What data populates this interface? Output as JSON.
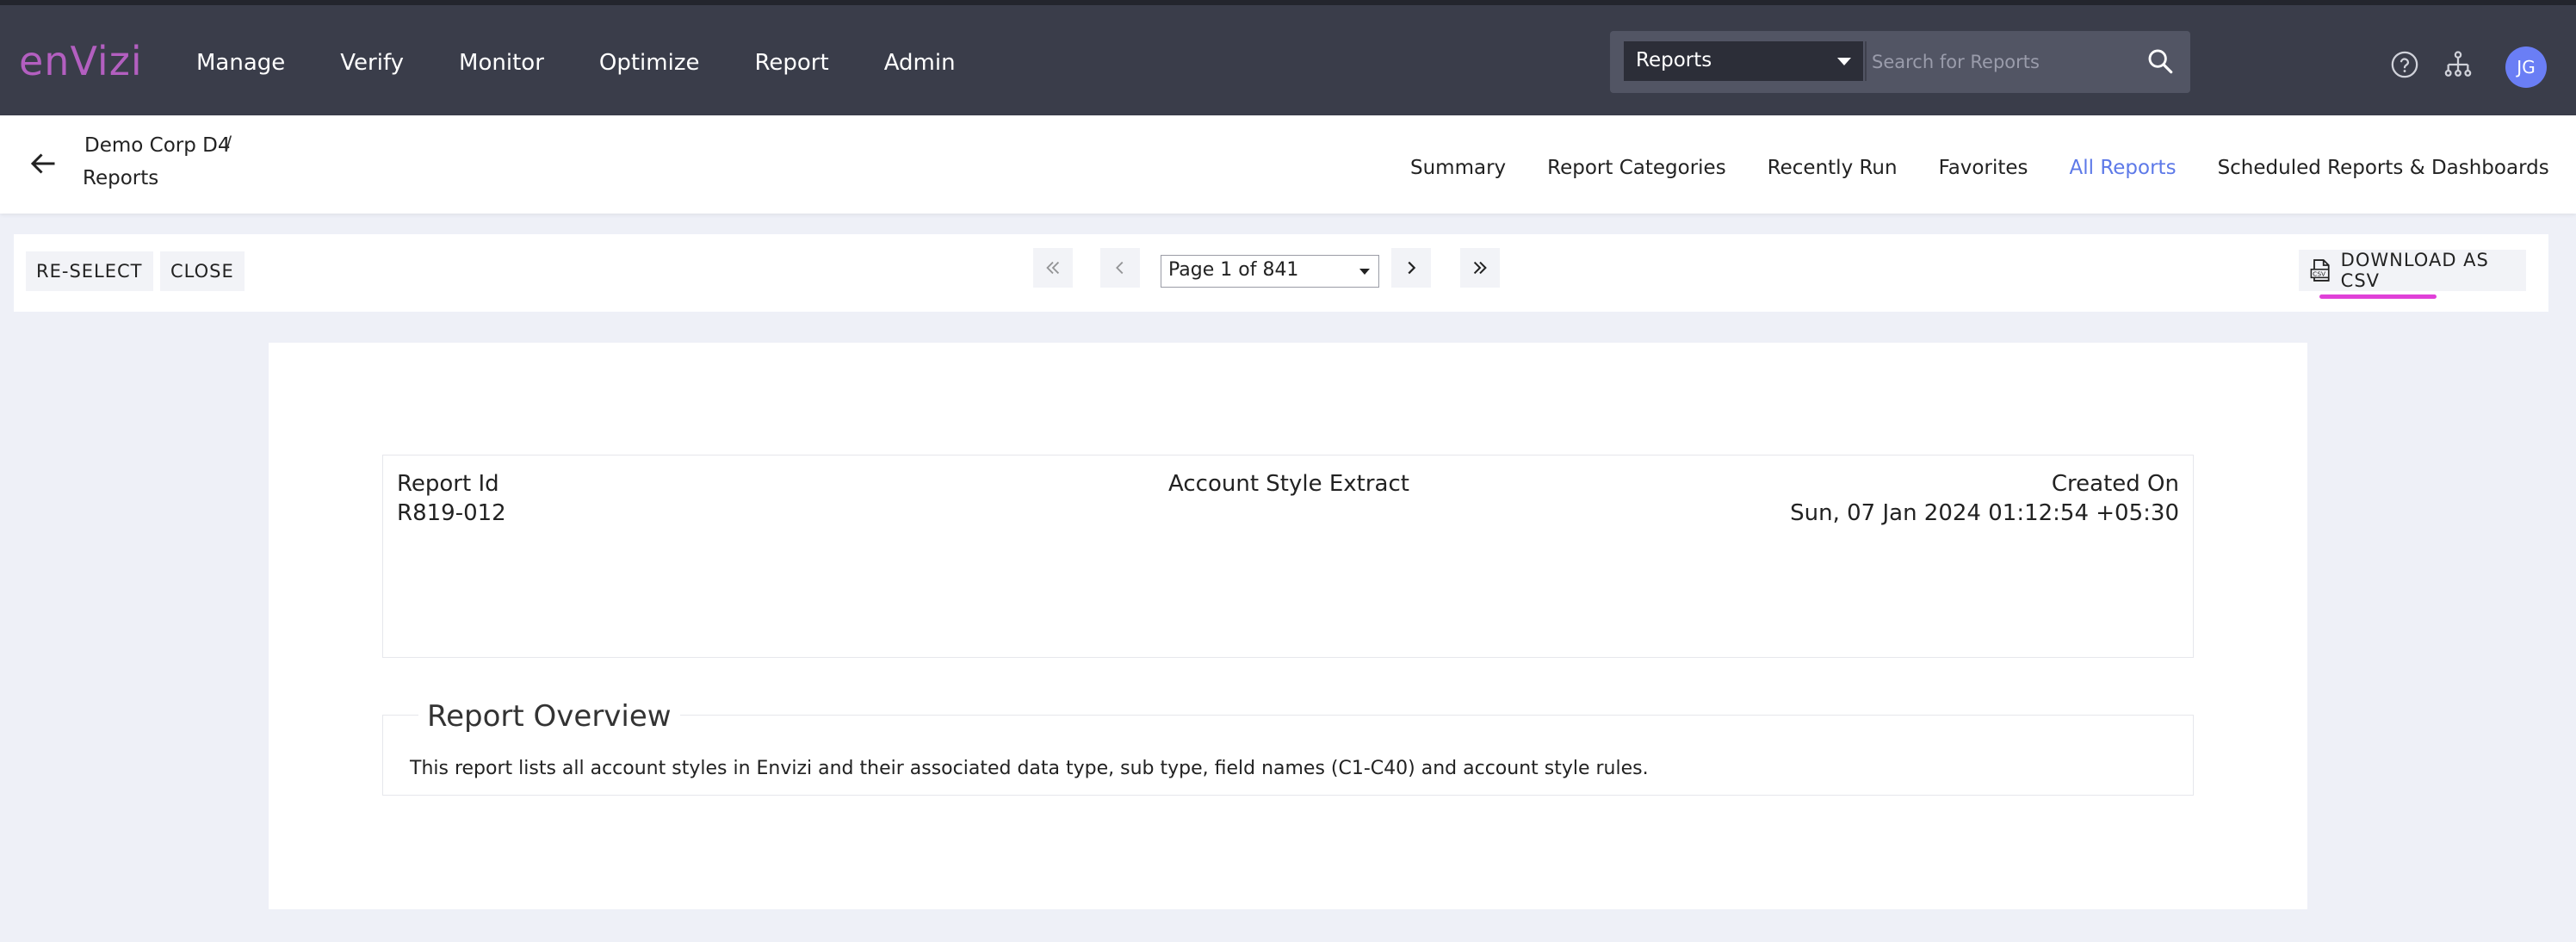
{
  "app": {
    "logo": "enVizi",
    "nav": [
      "Manage",
      "Verify",
      "Monitor",
      "Optimize",
      "Report",
      "Admin"
    ],
    "search": {
      "scope": "Reports",
      "placeholder": "Search for Reports"
    },
    "avatar_initials": "JG",
    "icons": [
      "help-icon",
      "hierarchy-icon",
      "search-icon"
    ]
  },
  "breadcrumb": {
    "parent": "Demo Corp D4",
    "separator": "/",
    "current": "Reports"
  },
  "tabs": [
    {
      "label": "Summary",
      "active": false
    },
    {
      "label": "Report Categories",
      "active": false
    },
    {
      "label": "Recently Run",
      "active": false
    },
    {
      "label": "Favorites",
      "active": false
    },
    {
      "label": "All Reports",
      "active": true
    },
    {
      "label": "Scheduled Reports & Dashboards",
      "active": false
    }
  ],
  "toolbar": {
    "reselect_label": "RE-SELECT",
    "close_label": "CLOSE",
    "page_label": "Page 1 of 841",
    "download_label": "DOWNLOAD AS CSV"
  },
  "report": {
    "id_label": "Report Id",
    "id_value": "R819-012",
    "title": "Account Style Extract",
    "created_label": "Created On",
    "created_value": "Sun, 07 Jan 2024 01:12:54 +05:30",
    "overview_title": "Report Overview",
    "overview_text": "This report lists all account styles in Envizi and their associated data type, sub type, field names (C1-C40) and account style rules."
  },
  "colors": {
    "topbar": "#3a3d4a",
    "logo": "#b35fc0",
    "active_tab": "#5d79e8",
    "avatar": "#6a7ef5",
    "csv_underline": "#e040d8"
  }
}
